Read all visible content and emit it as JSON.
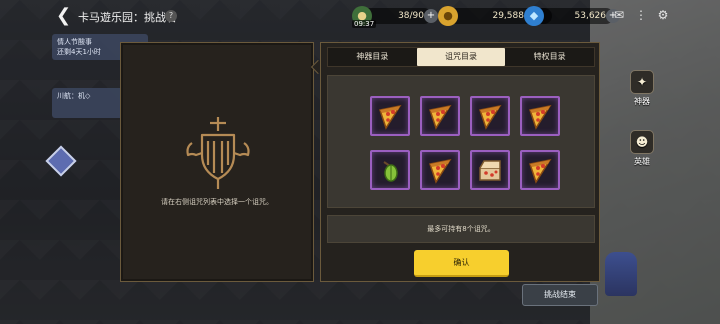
{
  "topbar": {
    "title": "卡马遊乐园：挑战者",
    "help": "?",
    "stamina": "38/90",
    "stamina_timer": "09:37",
    "gold": "29,588,050",
    "gems": "53,626",
    "plus": "+"
  },
  "side_notes": {
    "event_title": "情人节酸事",
    "event_time": "还剩4天1小时",
    "note2": "川航：机◇"
  },
  "left_panel": {
    "hint": "请在右侧诅咒列表中选择一个诅咒。"
  },
  "tabs": [
    {
      "label": "神器目录",
      "active": false
    },
    {
      "label": "诅咒目录",
      "active": true
    },
    {
      "label": "特权目录",
      "active": false
    }
  ],
  "curse_slots": [
    {
      "icon": "pizza-slice-icon"
    },
    {
      "icon": "pizza-slice-icon"
    },
    {
      "icon": "pizza-slice-icon"
    },
    {
      "icon": "pizza-slice-icon"
    },
    {
      "icon": "leaf-sprout-icon"
    },
    {
      "icon": "pizza-slice-icon"
    },
    {
      "icon": "pizza-box-icon"
    },
    {
      "icon": "pizza-slice-icon"
    }
  ],
  "info_text": "最多可持有8个诅咒。",
  "confirm_label": "确认",
  "right_sidebar": {
    "artifact_label": "神器",
    "hero_label": "英雄",
    "end_challenge": "挑战结束"
  },
  "colors": {
    "slot_border": "#9b5fc0",
    "confirm": "#f7cf2d",
    "tab_active": "#f1e6cc"
  }
}
